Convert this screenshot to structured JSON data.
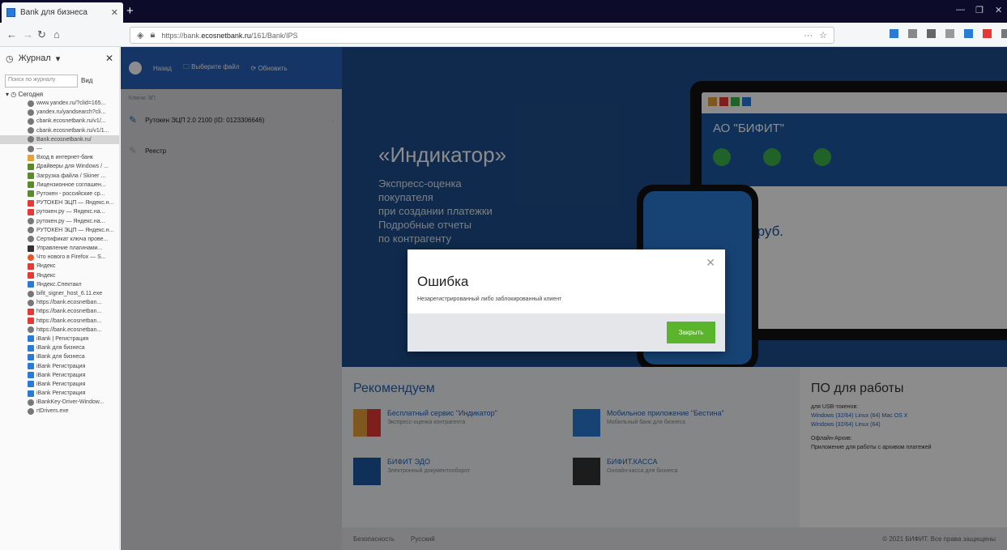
{
  "browser": {
    "tab_title": "Bank для бизнеса",
    "new_tab_label": "+",
    "url_prefix": "https://bank.",
    "url_domain": "ecosnetbank.ru",
    "url_suffix": "/161/Bank/IPS",
    "window_controls": [
      "—",
      "❐",
      "✕"
    ]
  },
  "sidebar": {
    "title": "Журнал",
    "search_placeholder": "Поиск по журналу",
    "view_button": "Вид",
    "group_label": "Сегодня",
    "items": [
      {
        "label": "www.yandex.ru/?clid=165...",
        "icon": "globe-icon",
        "color": "#777"
      },
      {
        "label": "yandex.ru/yandsearch?cli...",
        "icon": "globe-icon",
        "color": "#777"
      },
      {
        "label": "cbank.ecosnetbank.ru/v1/...",
        "icon": "globe-icon",
        "color": "#777"
      },
      {
        "label": "cbank.ecosnetbank.ru/v1/1...",
        "icon": "globe-icon",
        "color": "#777"
      },
      {
        "label": "Bank.ecosnetbank.ru/",
        "icon": "globe-icon",
        "color": "#777",
        "selected": true
      },
      {
        "label": "—",
        "icon": "globe-icon",
        "color": "#777"
      },
      {
        "label": "Вход в интернет-банк",
        "icon": "flag-icon",
        "color": "#e8a03a"
      },
      {
        "label": "Драйверы для Windows / ...",
        "icon": "puzzle-icon",
        "color": "#5a8a2a"
      },
      {
        "label": "Загрузка файла / Skiner ...",
        "icon": "puzzle-icon",
        "color": "#5a8a2a"
      },
      {
        "label": "Лицензионное соглашен...",
        "icon": "puzzle-icon",
        "color": "#5a8a2a"
      },
      {
        "label": "Рутокен - российские ср...",
        "icon": "puzzle-icon",
        "color": "#5a8a2a"
      },
      {
        "label": "РУТОКЕН ЭЦП — Яндекс.н...",
        "icon": "yandex-icon",
        "color": "#e53935"
      },
      {
        "label": "рутокен.ру — Яндекс.на...",
        "icon": "yandex-icon",
        "color": "#e53935"
      },
      {
        "label": "рутокен.ру — Яндекс.на...",
        "icon": "globe-icon",
        "color": "#777"
      },
      {
        "label": "РУТОКЕН ЭЦП — Яндекс.н...",
        "icon": "globe-icon",
        "color": "#777"
      },
      {
        "label": "Сертификат ключа прове...",
        "icon": "globe-icon",
        "color": "#777"
      },
      {
        "label": "Управление плагинами...",
        "icon": "terminal-icon",
        "color": "#333"
      },
      {
        "label": "Что нового в Firefox — S...",
        "icon": "firefox-icon",
        "color": "#e8572a"
      },
      {
        "label": "Яндекс",
        "icon": "yandex-icon",
        "color": "#e53935"
      },
      {
        "label": "Яндекс",
        "icon": "yandex-icon",
        "color": "#e53935"
      },
      {
        "label": "Яндекс.Спектакл",
        "icon": "cart-icon",
        "color": "#2a7bd4"
      },
      {
        "label": "bifit_signer_host_6.11.exe",
        "icon": "globe-icon",
        "color": "#777"
      },
      {
        "label": "https://bank.ecosnetban...",
        "icon": "globe-icon",
        "color": "#777"
      },
      {
        "label": "https://bank.ecosnetban...",
        "icon": "yandex-icon",
        "color": "#e53935"
      },
      {
        "label": "https://bank.ecosnetban...",
        "icon": "yandex-icon",
        "color": "#e53935"
      },
      {
        "label": "https://bank.ecosnetban...",
        "icon": "globe-icon",
        "color": "#777"
      },
      {
        "label": "iBank | Регистрация",
        "icon": "ibank-icon",
        "color": "#2a7bd4"
      },
      {
        "label": "iBank для бизнеса",
        "icon": "ibank-icon",
        "color": "#2a7bd4"
      },
      {
        "label": "iBank для бизнеса",
        "icon": "ibank-icon",
        "color": "#2a7bd4"
      },
      {
        "label": "iBank Регистрация",
        "icon": "ibank-icon",
        "color": "#2a7bd4"
      },
      {
        "label": "iBank Регистрация",
        "icon": "ibank-icon",
        "color": "#2a7bd4"
      },
      {
        "label": "iBank Регистрация",
        "icon": "ibank-icon",
        "color": "#2a7bd4"
      },
      {
        "label": "iBank Регистрация",
        "icon": "ibank-icon",
        "color": "#2a7bd4"
      },
      {
        "label": "iBankKey-Driver-Window...",
        "icon": "globe-icon",
        "color": "#777"
      },
      {
        "label": "rtDrivers.exe",
        "icon": "globe-icon",
        "color": "#777"
      }
    ]
  },
  "left_panel": {
    "toolbar": {
      "back": "Назад",
      "select_file": "Выберите файл",
      "refresh": "Обновить"
    },
    "section": "Ключи ЭП",
    "keys": [
      {
        "label": "Рутокен ЭЦП 2.0 2100 (ID: 0123306646)"
      },
      {
        "label": "Реестр"
      }
    ]
  },
  "hero": {
    "title": "«Индикатор»",
    "lines": [
      "Экспресс-оценка",
      "покупателя",
      "при создании платежки",
      "Подробные отчеты",
      "по контрагенту"
    ],
    "company": "АО \"БИФИТ\"",
    "amount": "4 млн. руб."
  },
  "recommend": {
    "title": "Рекомендуем",
    "items": [
      {
        "title": "Бесплатный сервис \"Индикатор\"",
        "desc": "Экспресс-оценка контрагента"
      },
      {
        "title": "Мобильное приложение \"Бестина\"",
        "desc": "Мобильный банк для бизнеса"
      },
      {
        "title": "БИФИТ ЭДО",
        "desc": "Электронный документооборот"
      },
      {
        "title": "БИФИТ.КАССА",
        "desc": "Онлайн-касса для бизнеса"
      }
    ]
  },
  "po": {
    "title": "ПО для работы",
    "line1": "для USB-токенов:",
    "links1": "Windows (32/64)   Linux (64)   Mac OS X",
    "links2": "Windows (32/64)   Linux (64)",
    "line2": "Офлайн-Архив:",
    "desc": "Приложение для работы с архивом платежей"
  },
  "footer": {
    "left1": "Безопасность",
    "left2": "Русский",
    "copy": "© 2021 БИФИТ. Все права защищены"
  },
  "modal": {
    "title": "Ошибка",
    "message": "Незарегистрированный либо заблокированный клиент",
    "close_button": "Закрыть"
  },
  "colors": {
    "accent": "#2561b8",
    "button_green": "#5ab52c"
  }
}
